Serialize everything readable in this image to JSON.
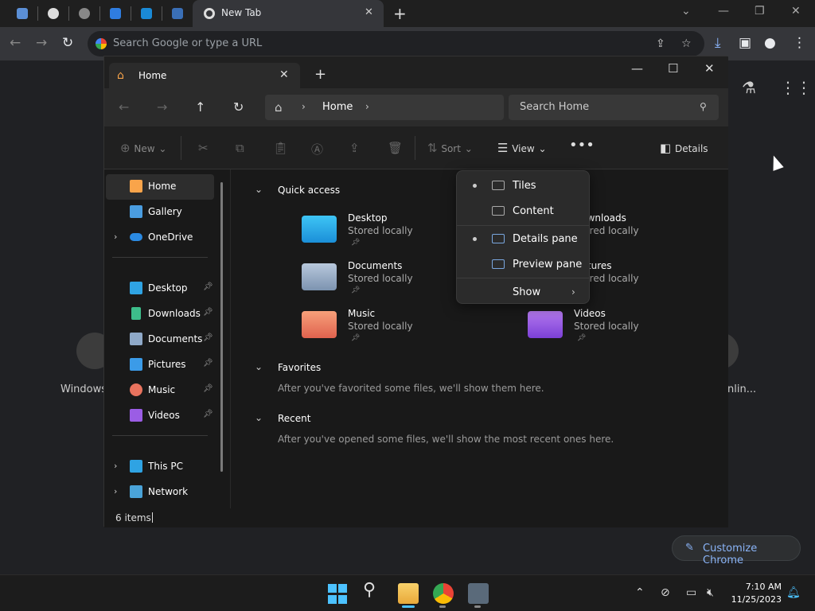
{
  "chrome": {
    "tab_title": "New Tab",
    "omnibox_placeholder": "Search Google or type a URL",
    "ntp": {
      "shortcut_left_label": "Windows...",
      "shortcut_right_label": "nlin...",
      "customize_label": "Customize Chrome"
    }
  },
  "explorer": {
    "tab_title": "Home",
    "breadcrumb": "Home",
    "search_placeholder": "Search Home",
    "commands": {
      "new": "New",
      "sort": "Sort",
      "view": "View",
      "details": "Details"
    },
    "nav": {
      "items": [
        {
          "label": "Home",
          "icon": "home-icon"
        },
        {
          "label": "Gallery",
          "icon": "gallery-icon"
        },
        {
          "label": "OneDrive",
          "icon": "onedrive-icon"
        },
        {
          "label": "Desktop",
          "icon": "desktop-folder-icon"
        },
        {
          "label": "Downloads",
          "icon": "downloads-icon"
        },
        {
          "label": "Documents",
          "icon": "documents-icon"
        },
        {
          "label": "Pictures",
          "icon": "pictures-icon"
        },
        {
          "label": "Music",
          "icon": "music-icon"
        },
        {
          "label": "Videos",
          "icon": "videos-icon"
        },
        {
          "label": "This PC",
          "icon": "this-pc-icon"
        },
        {
          "label": "Network",
          "icon": "network-icon"
        }
      ]
    },
    "sections": {
      "quick_access": "Quick access",
      "favorites": "Favorites",
      "favorites_empty": "After you've favorited some files, we'll show them here.",
      "recent": "Recent",
      "recent_empty": "After you've opened some files, we'll show the most recent ones here."
    },
    "quick_access_items": [
      {
        "name": "Desktop",
        "sub": "Stored locally"
      },
      {
        "name": "Downloads",
        "sub": "Stored locally"
      },
      {
        "name": "Documents",
        "sub": "Stored locally"
      },
      {
        "name": "Pictures",
        "sub": "Stored locally"
      },
      {
        "name": "Music",
        "sub": "Stored locally"
      },
      {
        "name": "Videos",
        "sub": "Stored locally"
      }
    ],
    "status_count": "6 items"
  },
  "view_menu": {
    "items": [
      {
        "label": "Tiles",
        "checked": true
      },
      {
        "label": "Content",
        "checked": false
      },
      {
        "label": "Details pane",
        "checked": true
      },
      {
        "label": "Preview pane",
        "checked": false
      },
      {
        "label": "Show",
        "checked": false
      }
    ]
  },
  "taskbar": {
    "time": "7:10 AM",
    "date": "11/25/2023"
  },
  "colors": {
    "accent": "#4cc2ff",
    "folder": "#f9c74f",
    "link": "#8ab4f8"
  }
}
